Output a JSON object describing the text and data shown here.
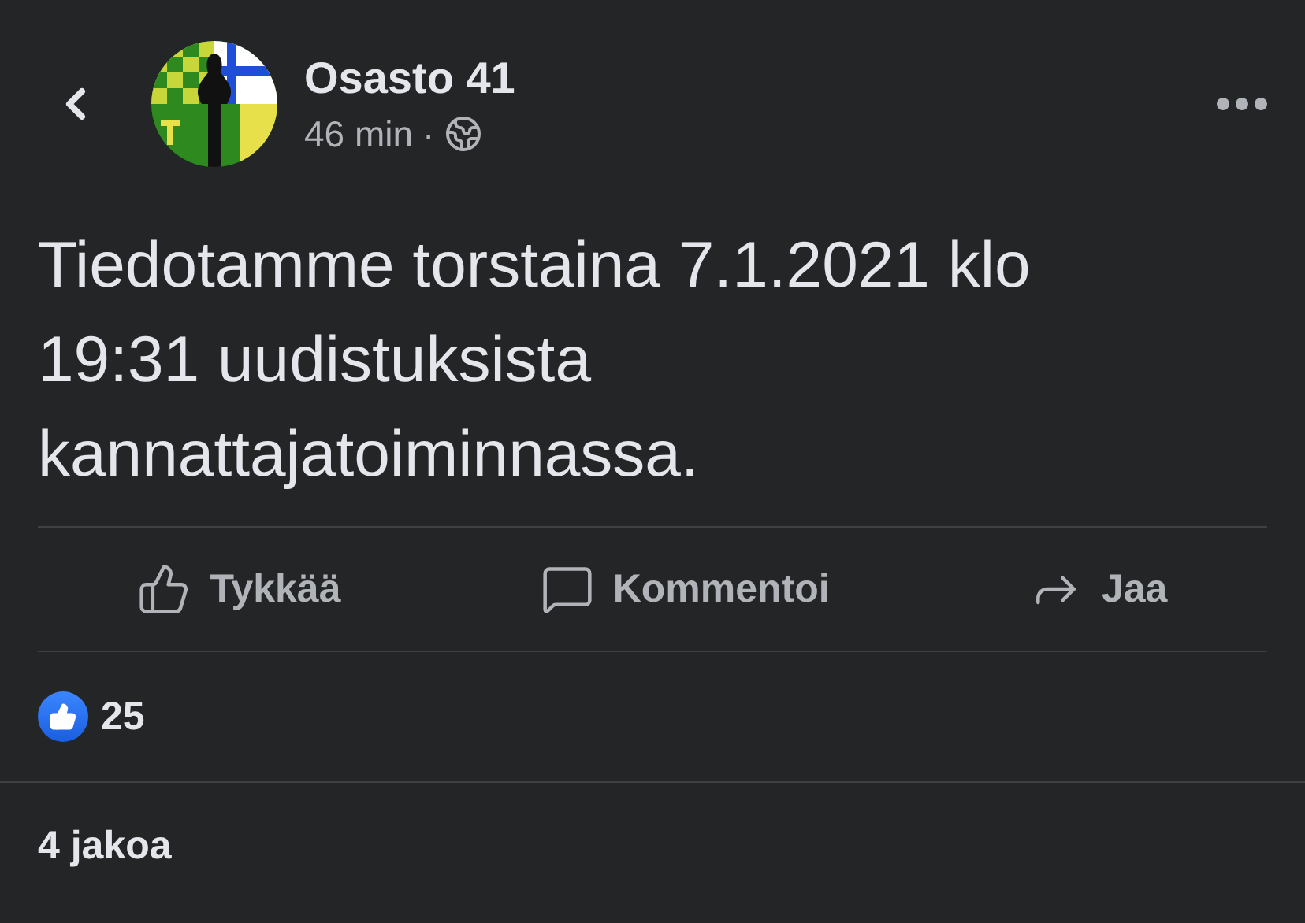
{
  "header": {
    "page_name": "Osasto 41",
    "time": "46 min",
    "separator": "·"
  },
  "post": {
    "text_lines": [
      "Tiedotamme torstaina 7.1.2021 klo",
      "19:31 uudistuksista",
      "kannattajatoiminnassa."
    ]
  },
  "actions": [
    {
      "kind": "like",
      "label": "Tykkää"
    },
    {
      "kind": "comment",
      "label": "Kommentoi"
    },
    {
      "kind": "share",
      "label": "Jaa"
    }
  ],
  "reactions": {
    "count": "25"
  },
  "shares": "4 jakoa"
}
